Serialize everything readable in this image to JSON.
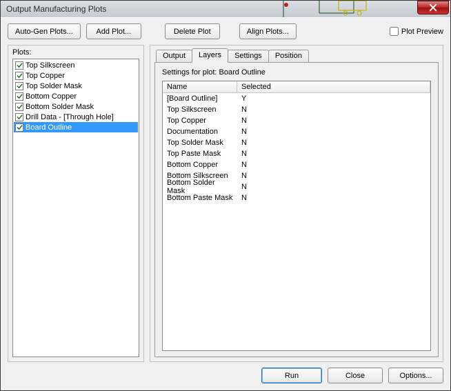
{
  "window": {
    "title": "Output Manufacturing Plots"
  },
  "toolbar": {
    "auto_gen": "Auto-Gen Plots...",
    "add_plot": "Add Plot...",
    "delete_plot": "Delete Plot",
    "align_plots": "Align Plots...",
    "plot_preview_label": "Plot Preview",
    "plot_preview_checked": false
  },
  "left": {
    "label": "Plots:",
    "items": [
      {
        "checked": true,
        "label": "Top Silkscreen",
        "selected": false
      },
      {
        "checked": true,
        "label": "Top Copper",
        "selected": false
      },
      {
        "checked": true,
        "label": "Top Solder Mask",
        "selected": false
      },
      {
        "checked": true,
        "label": "Bottom Copper",
        "selected": false
      },
      {
        "checked": true,
        "label": "Bottom Solder Mask",
        "selected": false
      },
      {
        "checked": true,
        "label": "Drill Data - [Through Hole]",
        "selected": false
      },
      {
        "checked": true,
        "label": "Board Outline",
        "selected": true
      }
    ]
  },
  "tabs": {
    "items": [
      {
        "label": "Output",
        "active": false
      },
      {
        "label": "Layers",
        "active": true
      },
      {
        "label": "Settings",
        "active": false
      },
      {
        "label": "Position",
        "active": false
      }
    ]
  },
  "layers_panel": {
    "heading": "Settings for plot: Board Outline",
    "columns": {
      "name": "Name",
      "selected": "Selected"
    },
    "rows": [
      {
        "name": "[Board Outline]",
        "selected": "Y"
      },
      {
        "name": "Top Silkscreen",
        "selected": "N"
      },
      {
        "name": "Top Copper",
        "selected": "N"
      },
      {
        "name": "Documentation",
        "selected": "N"
      },
      {
        "name": "Top Solder Mask",
        "selected": "N"
      },
      {
        "name": "Top Paste Mask",
        "selected": "N"
      },
      {
        "name": "Bottom Copper",
        "selected": "N"
      },
      {
        "name": "Bottom Silkscreen",
        "selected": "N"
      },
      {
        "name": "Bottom Solder Mask",
        "selected": "N"
      },
      {
        "name": "Bottom Paste Mask",
        "selected": "N"
      }
    ]
  },
  "bottom": {
    "run": "Run",
    "close": "Close",
    "options": "Options..."
  }
}
